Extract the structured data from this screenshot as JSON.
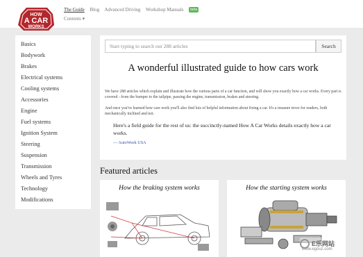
{
  "logo": {
    "text": "HOW A CAR WORKS",
    "color": "#b3262b"
  },
  "nav": {
    "items": [
      "The Guide",
      "Blog",
      "Advanced Driving",
      "Workshop Manuals"
    ],
    "beta_label": "beta",
    "contents_label": "Contents ▾"
  },
  "sidebar": {
    "items": [
      "Basics",
      "Bodywork",
      "Brakes",
      "Electrical systems",
      "Cooling systems",
      "Accessories",
      "Engine",
      "Fuel systems",
      "Ignition System",
      "Steering",
      "Suspension",
      "Transmission",
      "Wheels and Tyres",
      "Technology",
      "Modifications"
    ]
  },
  "search": {
    "placeholder": "Start typing to search our 288 articles",
    "button_label": "Search"
  },
  "main": {
    "heading": "A wonderful illustrated guide to how cars work",
    "paragraph1": "We have 288 articles which explain and illustrate how the various parts of a car function, and will show you exactly how a car works. Every part is covered - from the bumper to the tailpipe, passing the engine, transmission, brakes and steering.",
    "paragraph2": "And once you've learned how cars work you'll also find lots of helpful information about fixing a car. It's a treasure trove for readers, both mechanically inclined and not.",
    "quote": "Here's a field guide for the rest of us: the succinctly-named How A Car Works details exactly how a car works.",
    "quote_source": "— AutoWeek USA"
  },
  "featured": {
    "heading": "Featured articles",
    "articles": [
      {
        "title": "How the braking system works"
      },
      {
        "title": "How the starting system works"
      }
    ]
  },
  "watermark": {
    "text": "E乐网站",
    "url": "www.egouz.com"
  }
}
